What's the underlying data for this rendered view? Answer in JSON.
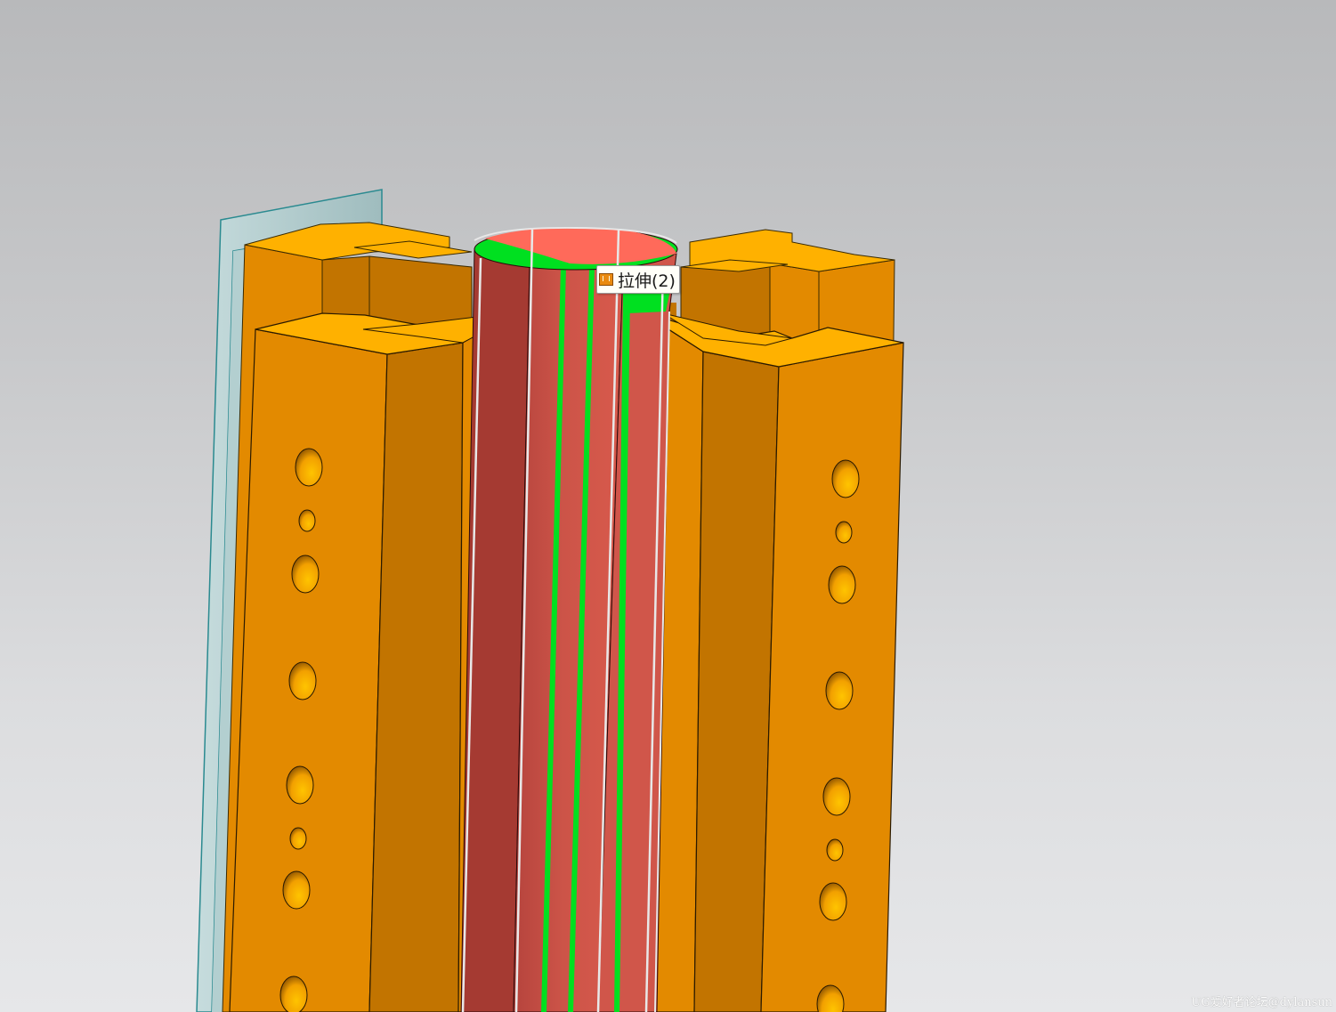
{
  "viewport": {
    "background_top": "#b8b9bb",
    "background_bottom": "#e6e7e9"
  },
  "model": {
    "body_color": "#e38a00",
    "top_face_color": "#ffb100",
    "shadow_face_color": "#c27400",
    "datum_plane_color": "#a9c6c8",
    "datum_plane_edge": "#2a8a90",
    "selected_face_color": "#c8534a",
    "selected_top_color": "#ff6a5a",
    "highlight_color": "#00e020",
    "edge_preview_color": "#e8e8e8"
  },
  "tooltip": {
    "icon": "extrude-feature-icon",
    "label": "拉伸(2)"
  },
  "watermark": {
    "text": "UG爱好者论坛@dylansun"
  }
}
